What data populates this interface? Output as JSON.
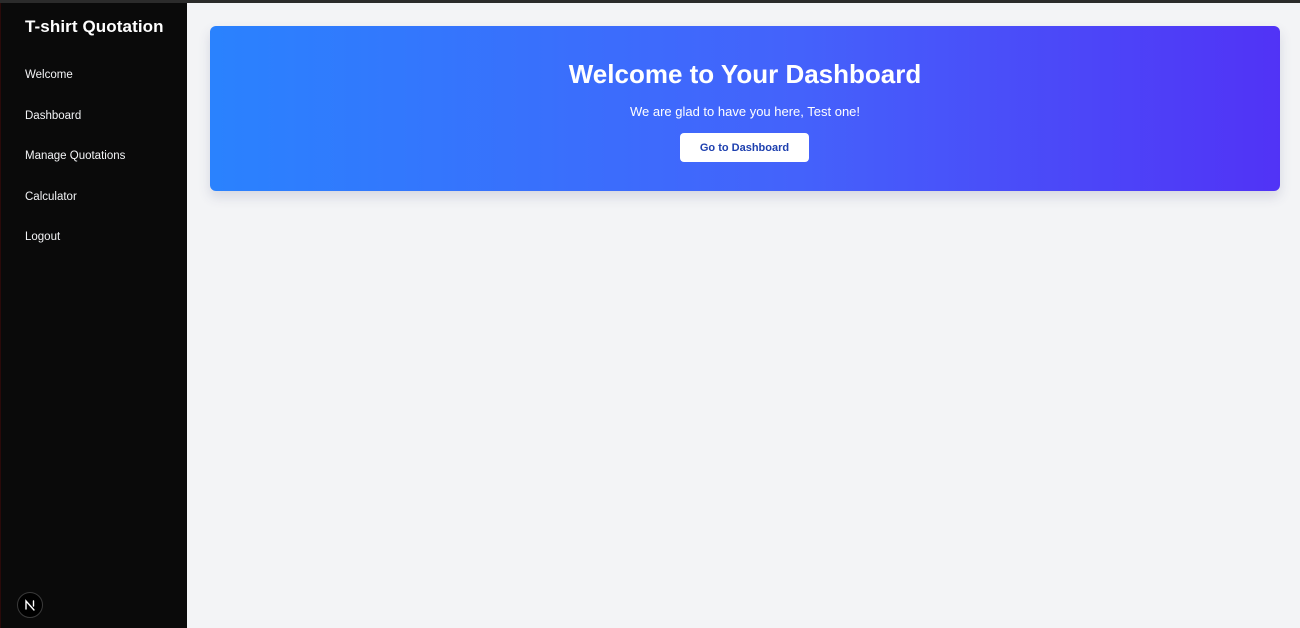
{
  "sidebar": {
    "brand": "T-shirt Quotation",
    "items": [
      {
        "label": "Welcome"
      },
      {
        "label": "Dashboard"
      },
      {
        "label": "Manage Quotations"
      },
      {
        "label": "Calculator"
      },
      {
        "label": "Logout"
      }
    ],
    "badge_icon": "nextjs-logo-icon",
    "badge_letter": "N"
  },
  "hero": {
    "title": "Welcome to Your Dashboard",
    "subtitle": "We are glad to have you here, Test one!",
    "button_label": "Go to Dashboard"
  },
  "colors": {
    "sidebar_bg": "#0a0a0a",
    "page_bg": "#f3f4f6",
    "gradient_start": "#2a82fe",
    "gradient_end": "#5133f6",
    "button_text": "#1e40af"
  }
}
